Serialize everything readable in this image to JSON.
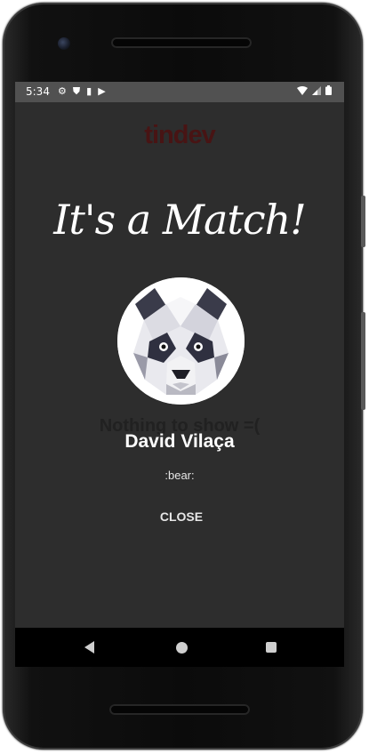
{
  "status_bar": {
    "time": "5:34",
    "left_icons": [
      "gear-icon",
      "shield-icon",
      "sd-card-icon",
      "play-store-icon"
    ],
    "right_icons": [
      "wifi-icon",
      "cell-signal-icon",
      "battery-icon"
    ]
  },
  "app": {
    "logo_text": "tindev",
    "background_message": "Nothing to show =("
  },
  "match_dialog": {
    "title": "It's a Match!",
    "user_name": "David Vilaça",
    "bio": ":bear:",
    "close_label": "CLOSE"
  },
  "nav_bar": {
    "buttons": [
      "back-icon",
      "home-icon",
      "recent-apps-icon"
    ]
  },
  "colors": {
    "screen_bg": "#2e2e2e",
    "status_bar_bg": "#515151",
    "logo_color": "#4a1515",
    "text_primary": "#ffffff"
  }
}
